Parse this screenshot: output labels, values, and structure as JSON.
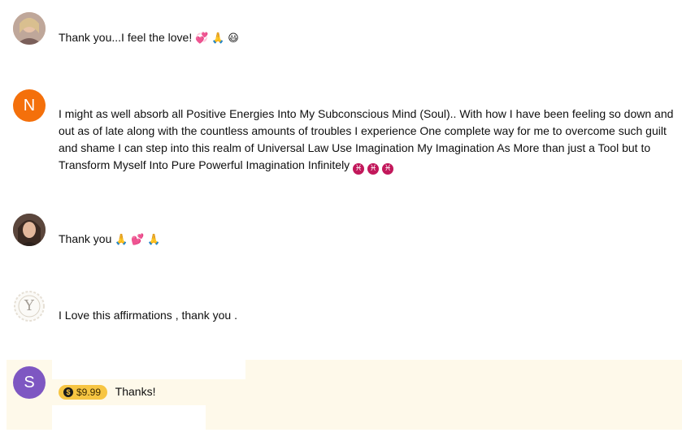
{
  "comments": [
    {
      "avatar_icon": "user-photo-blonde-woman",
      "text": "Thank you...I feel the love!",
      "emojis": [
        "💞",
        "🙏",
        "😃"
      ]
    },
    {
      "avatar_letter": "N",
      "avatar_color": "#f4700b",
      "text": "I might as well absorb all Positive Energies Into My Subconscious Mind (Soul).. With how I have been feeling so down and out as of late along with the countless amounts of troubles I experience One complete way for me to overcome such guilt and shame I can step into this realm of Universal Law Use Imagination My Imagination As More than just a Tool but to Transform Myself Into Pure Powerful Imagination Infinitely",
      "emojis": [
        "♓",
        "♓",
        "♓"
      ]
    },
    {
      "avatar_icon": "user-photo-dark-haired-woman",
      "text": "Thank you",
      "emojis": [
        "🙏",
        "💕",
        "🙏"
      ]
    },
    {
      "avatar_letter": "Y",
      "avatar_icon": "monogram-y-logo",
      "text": "I Love this affirmations , thank you ."
    },
    {
      "avatar_letter": "S",
      "avatar_color": "#7e57c2",
      "superchat_amount": "$9.99",
      "superchat_color": "#f7c542",
      "text": "Thanks!"
    }
  ]
}
